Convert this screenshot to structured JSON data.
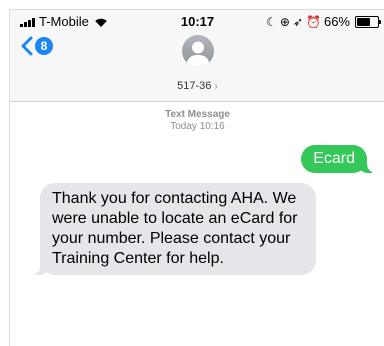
{
  "status_bar": {
    "carrier": "T-Mobile",
    "time": "10:17",
    "battery_percent": "66%",
    "battery_level": 0.66
  },
  "nav": {
    "unread_count": "8"
  },
  "contact": {
    "name": "517-36",
    "chevron": "›"
  },
  "thread": {
    "service": "Text Message",
    "timestamp": "Today 10:16"
  },
  "messages": [
    {
      "direction": "outgoing",
      "text": "Ecard"
    },
    {
      "direction": "incoming",
      "text": "Thank you for contacting AHA.  We were unable to locate an eCard for your number.  Please contact your Training Center for help."
    }
  ],
  "colors": {
    "accent_blue": "#1a86f5",
    "outgoing_bubble": "#34c759",
    "incoming_bubble": "#e5e5ea"
  }
}
